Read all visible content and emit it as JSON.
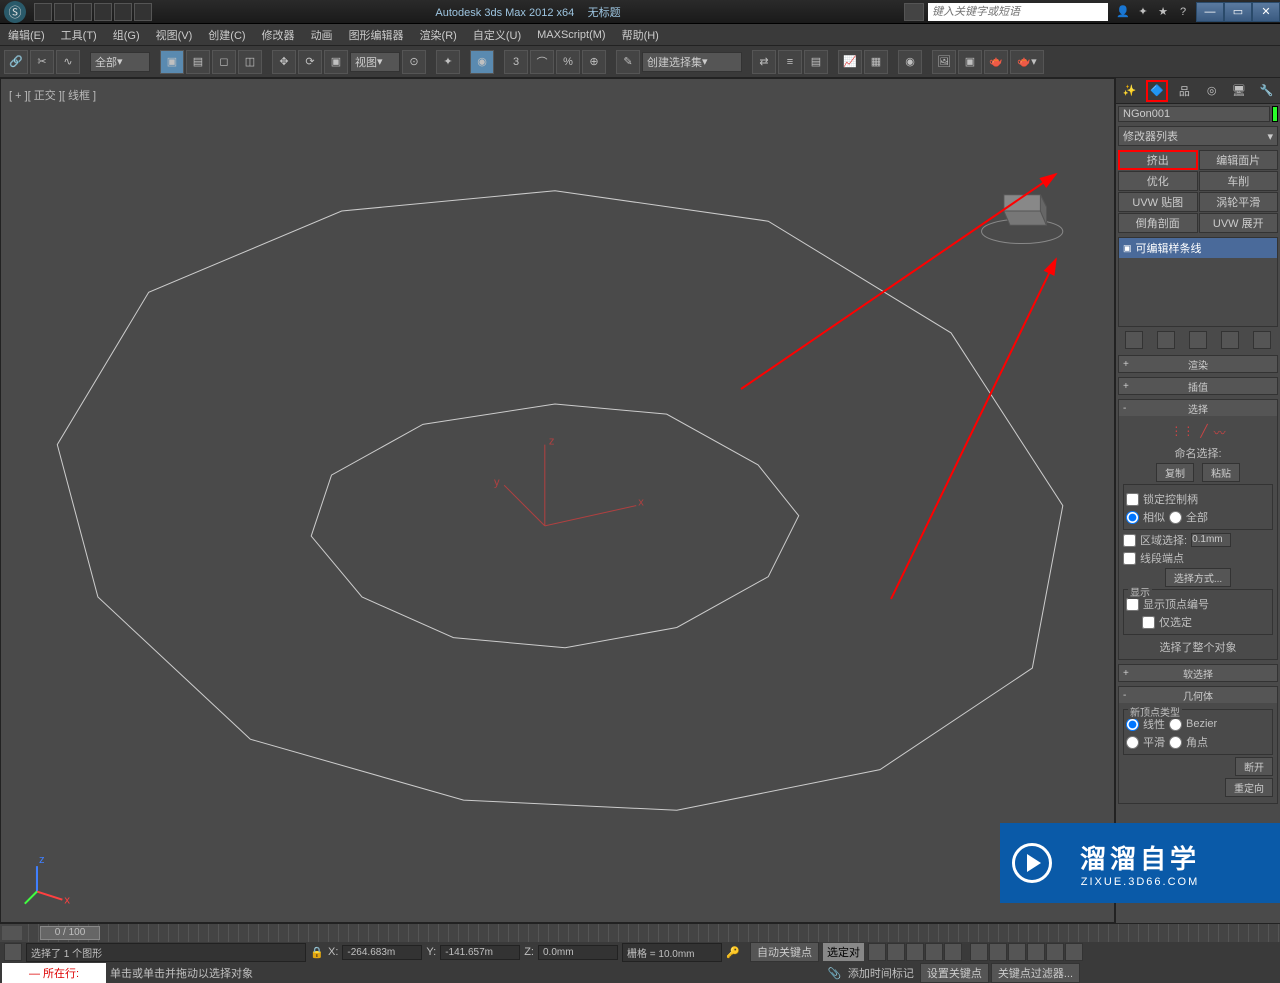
{
  "title": {
    "app": "Autodesk 3ds Max  2012 x64",
    "doc": "无标题"
  },
  "search_placeholder": "键入关键字或短语",
  "menu": [
    "编辑(E)",
    "工具(T)",
    "组(G)",
    "视图(V)",
    "创建(C)",
    "修改器",
    "动画",
    "图形编辑器",
    "渲染(R)",
    "自定义(U)",
    "MAXScript(M)",
    "帮助(H)"
  ],
  "toolbar": {
    "selection_set": "全部",
    "view_dd": "视图",
    "named_sel": "创建选择集"
  },
  "viewport_label": "[ + ][ 正交 ][ 线框 ]",
  "panel": {
    "object_name": "NGon001",
    "mod_list_label": "修改器列表",
    "mod_buttons": [
      "挤出",
      "编辑面片",
      "优化",
      "车削",
      "UVW 贴图",
      "涡轮平滑",
      "倒角剖面",
      "UVW 展开"
    ],
    "stack_item": "可编辑样条线",
    "rollouts": {
      "render": "渲染",
      "interp": "插值",
      "selection": "选择",
      "soft_sel": "软选择",
      "geometry": "几何体"
    },
    "selection": {
      "named_label": "命名选择:",
      "copy": "复制",
      "paste": "粘贴",
      "lock_handles": "锁定控制柄",
      "similar": "相似",
      "all": "全部",
      "area_select": "区域选择:",
      "area_val": "0.1mm",
      "segment_end": "线段端点",
      "select_by": "选择方式...",
      "display_group": "显示",
      "show_vertex_nums": "显示顶点编号",
      "selected_only": "仅选定",
      "whole_selected": "选择了整个对象"
    },
    "geometry": {
      "new_vertex_type": "新顶点类型",
      "linear": "线性",
      "bezier": "Bezier",
      "corner": "角点",
      "break": "断开",
      "redirect": "重定向"
    }
  },
  "timeline": {
    "frame": "0 / 100"
  },
  "status": {
    "selected_msg": "选择了 1 个图形",
    "click_msg": "单击或单击并拖动以选择对象",
    "x": "-264.683m",
    "y": "-141.657m",
    "z": "0.0mm",
    "grid": "栅格 = 10.0mm",
    "add_time_tag": "添加时间标记",
    "now_at": "所在行:",
    "auto_key": "自动关键点",
    "set_key": "设置关键点",
    "key_filters": "关键点过滤器...",
    "selected_locked": "选定对"
  },
  "watermark": {
    "name": "溜溜自学",
    "url": "ZIXUE.3D66.COM"
  }
}
